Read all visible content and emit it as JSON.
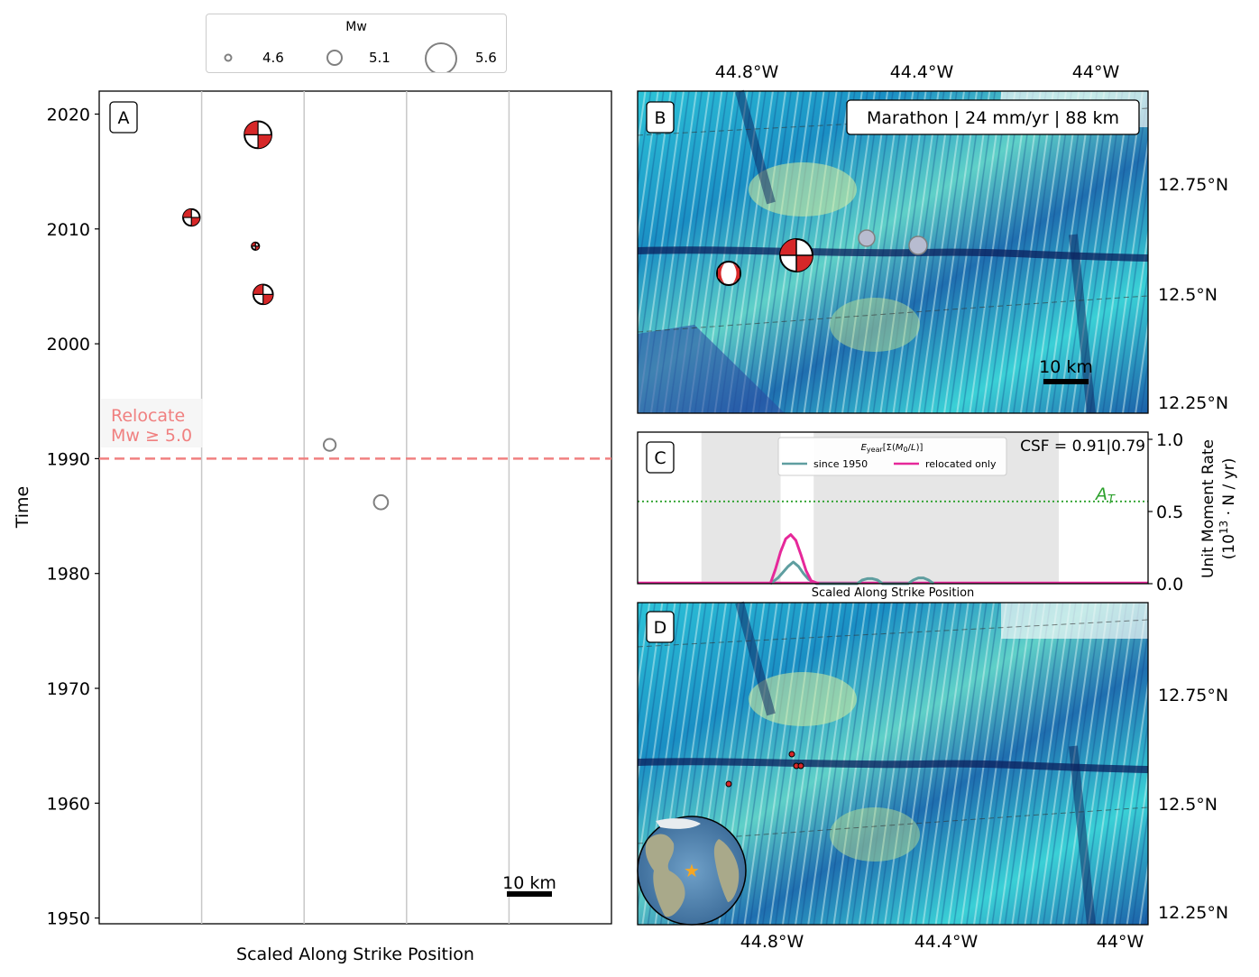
{
  "colors": {
    "beachball_fill": "#d62728",
    "open_circle": "#808080",
    "relocate_line": "#f08080",
    "relocate_text": "#f08080",
    "since1950": "#5f9ea0",
    "relocated_only": "#e6289a",
    "threshold": "#2ca02c",
    "shade": "#e6e6e6"
  },
  "legend_mw": {
    "title": "Mw",
    "entries": [
      {
        "label": "4.6",
        "mw": 4.6
      },
      {
        "label": "5.1",
        "mw": 5.1
      },
      {
        "label": "5.6",
        "mw": 5.6
      }
    ]
  },
  "panels": {
    "a": {
      "label": "A"
    },
    "b": {
      "label": "B",
      "info": "Marathon | 24 mm/yr | 88 km",
      "scalebar": "10 km"
    },
    "c": {
      "label": "C",
      "xlabel": "Scaled Along Strike Position",
      "csf": "CSF = 0.91|0.79",
      "threshold_label": "A_T"
    },
    "d": {
      "label": "D"
    }
  },
  "map_axes": {
    "top_lon_ticks": [
      "44.8°W",
      "44.4°W",
      "44°W"
    ],
    "bottom_lon_ticks": [
      "44.8°W",
      "44.4°W",
      "44°W"
    ],
    "b_lat_ticks": [
      "12.75°N",
      "12.5°N",
      "12.25°N"
    ],
    "d_lat_ticks": [
      "12.75°N",
      "12.5°N",
      "12.25°N"
    ]
  },
  "chart_data": [
    {
      "type": "scatter",
      "panel": "A",
      "xlabel": "Scaled Along Strike Position",
      "ylabel": "Time",
      "ylim": [
        1949.5,
        2022
      ],
      "yticks": [
        1950,
        1960,
        1970,
        1980,
        1990,
        2000,
        2010,
        2020
      ],
      "xlim": [
        0,
        1
      ],
      "grid_x": [
        0.2,
        0.4,
        0.6,
        0.8
      ],
      "relocate_threshold_year": 1990,
      "relocate_label": "Relocate\nMw ≥ 5.0",
      "scalebar_label": "10 km",
      "events": [
        {
          "x": 0.31,
          "year": 2018.2,
          "mw": 5.5,
          "kind": "mechanism"
        },
        {
          "x": 0.18,
          "year": 2011.0,
          "mw": 5.2,
          "kind": "mechanism"
        },
        {
          "x": 0.305,
          "year": 2008.5,
          "mw": 4.7,
          "kind": "mechanism"
        },
        {
          "x": 0.32,
          "year": 2004.3,
          "mw": 5.3,
          "kind": "mechanism"
        },
        {
          "x": 0.45,
          "year": 1991.2,
          "mw": 5.0,
          "kind": "catalog"
        },
        {
          "x": 0.55,
          "year": 1986.2,
          "mw": 5.1,
          "kind": "catalog"
        }
      ]
    },
    {
      "type": "line",
      "panel": "C",
      "xlabel": "Scaled Along Strike Position",
      "ylabel": "Unit Moment Rate\n(10^13 · N / yr)",
      "ylim": [
        0,
        1.0
      ],
      "yticks": [
        0.0,
        0.5,
        1.0
      ],
      "xlim": [
        0,
        1
      ],
      "legend_title": "E_year[Σ(M0/L)]",
      "threshold": 0.57,
      "shaded_ranges": [
        [
          0.125,
          0.28
        ],
        [
          0.345,
          0.825
        ]
      ],
      "series": [
        {
          "name": "since 1950",
          "x": [
            0.26,
            0.275,
            0.285,
            0.295,
            0.305,
            0.315,
            0.325,
            0.335,
            0.35,
            0.43,
            0.44,
            0.45,
            0.46,
            0.47,
            0.48,
            0.53,
            0.54,
            0.55,
            0.56,
            0.57,
            0.58
          ],
          "y": [
            0,
            0.04,
            0.08,
            0.12,
            0.15,
            0.12,
            0.07,
            0.03,
            0,
            0,
            0.025,
            0.035,
            0.035,
            0.025,
            0,
            0,
            0.025,
            0.04,
            0.04,
            0.025,
            0
          ]
        },
        {
          "name": "relocated only",
          "x": [
            0.26,
            0.27,
            0.28,
            0.29,
            0.3,
            0.31,
            0.32,
            0.33,
            0.34,
            0.355
          ],
          "y": [
            0,
            0.1,
            0.22,
            0.31,
            0.34,
            0.3,
            0.2,
            0.09,
            0.02,
            0
          ]
        }
      ]
    }
  ]
}
